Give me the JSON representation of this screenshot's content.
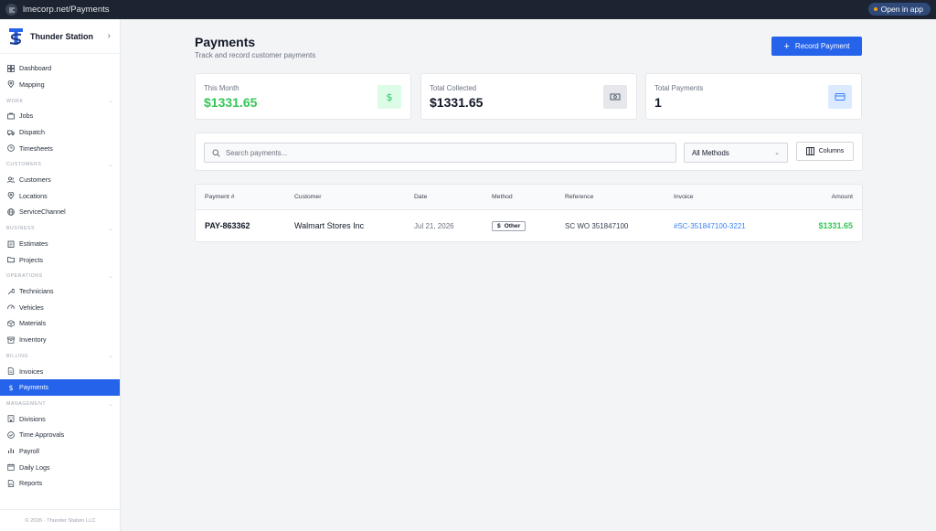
{
  "browser": {
    "url": "lmecorp.net/Payments",
    "open_app_label": "Open in app"
  },
  "brand": {
    "name": "Thunder Station",
    "logo_letter": "TS"
  },
  "sidebar": {
    "dashboard": "Dashboard",
    "mapping": "Mapping",
    "work_section": "WORK",
    "jobs": "Jobs",
    "dispatch": "Dispatch",
    "timesheets": "Timesheets",
    "customers_section": "CUSTOMERS",
    "customers": "Customers",
    "locations": "Locations",
    "servicechannel": "ServiceChannel",
    "business_section": "BUSINESS",
    "estimates": "Estimates",
    "projects": "Projects",
    "operations_section": "OPERATIONS",
    "technicians": "Technicians",
    "vehicles": "Vehicles",
    "materials": "Materials",
    "inventory": "Inventory",
    "billing_section": "BILLING",
    "invoices": "Invoices",
    "payments": "Payments",
    "management_section": "MANAGEMENT",
    "divisions": "Divisions",
    "time_approvals": "Time Approvals",
    "payroll": "Payroll",
    "daily_logs": "Daily Logs",
    "reports": "Reports",
    "footer": "© 2026 · Thunder Station LLC"
  },
  "header": {
    "title": "Payments",
    "subtitle": "Track and record customer payments",
    "record_button": "Record Payment"
  },
  "stats": {
    "this_month_label": "This Month",
    "this_month_value": "$1331.65",
    "total_collected_label": "Total Collected",
    "total_collected_value": "$1331.65",
    "total_payments_label": "Total Payments",
    "total_payments_value": "1"
  },
  "filters": {
    "search_placeholder": "Search payments...",
    "method_value": "All Methods",
    "columns_label": "Columns"
  },
  "table": {
    "headers": {
      "payment": "Payment #",
      "customer": "Customer",
      "date": "Date",
      "method": "Method",
      "reference": "Reference",
      "invoice": "Invoice",
      "amount": "Amount"
    },
    "rows": [
      {
        "payment": "PAY-863362",
        "customer": "Walmart Stores Inc",
        "date": "Jul 21, 2026",
        "method_symbol": "$",
        "method": "Other",
        "reference": "SC WO 351847100",
        "invoice": "#SC-351847100-3221",
        "amount": "$1331.65"
      }
    ]
  },
  "colors": {
    "accent": "#2563eb",
    "positive": "#34c759",
    "link": "#3b82f6",
    "topbar": "#1c2431"
  }
}
